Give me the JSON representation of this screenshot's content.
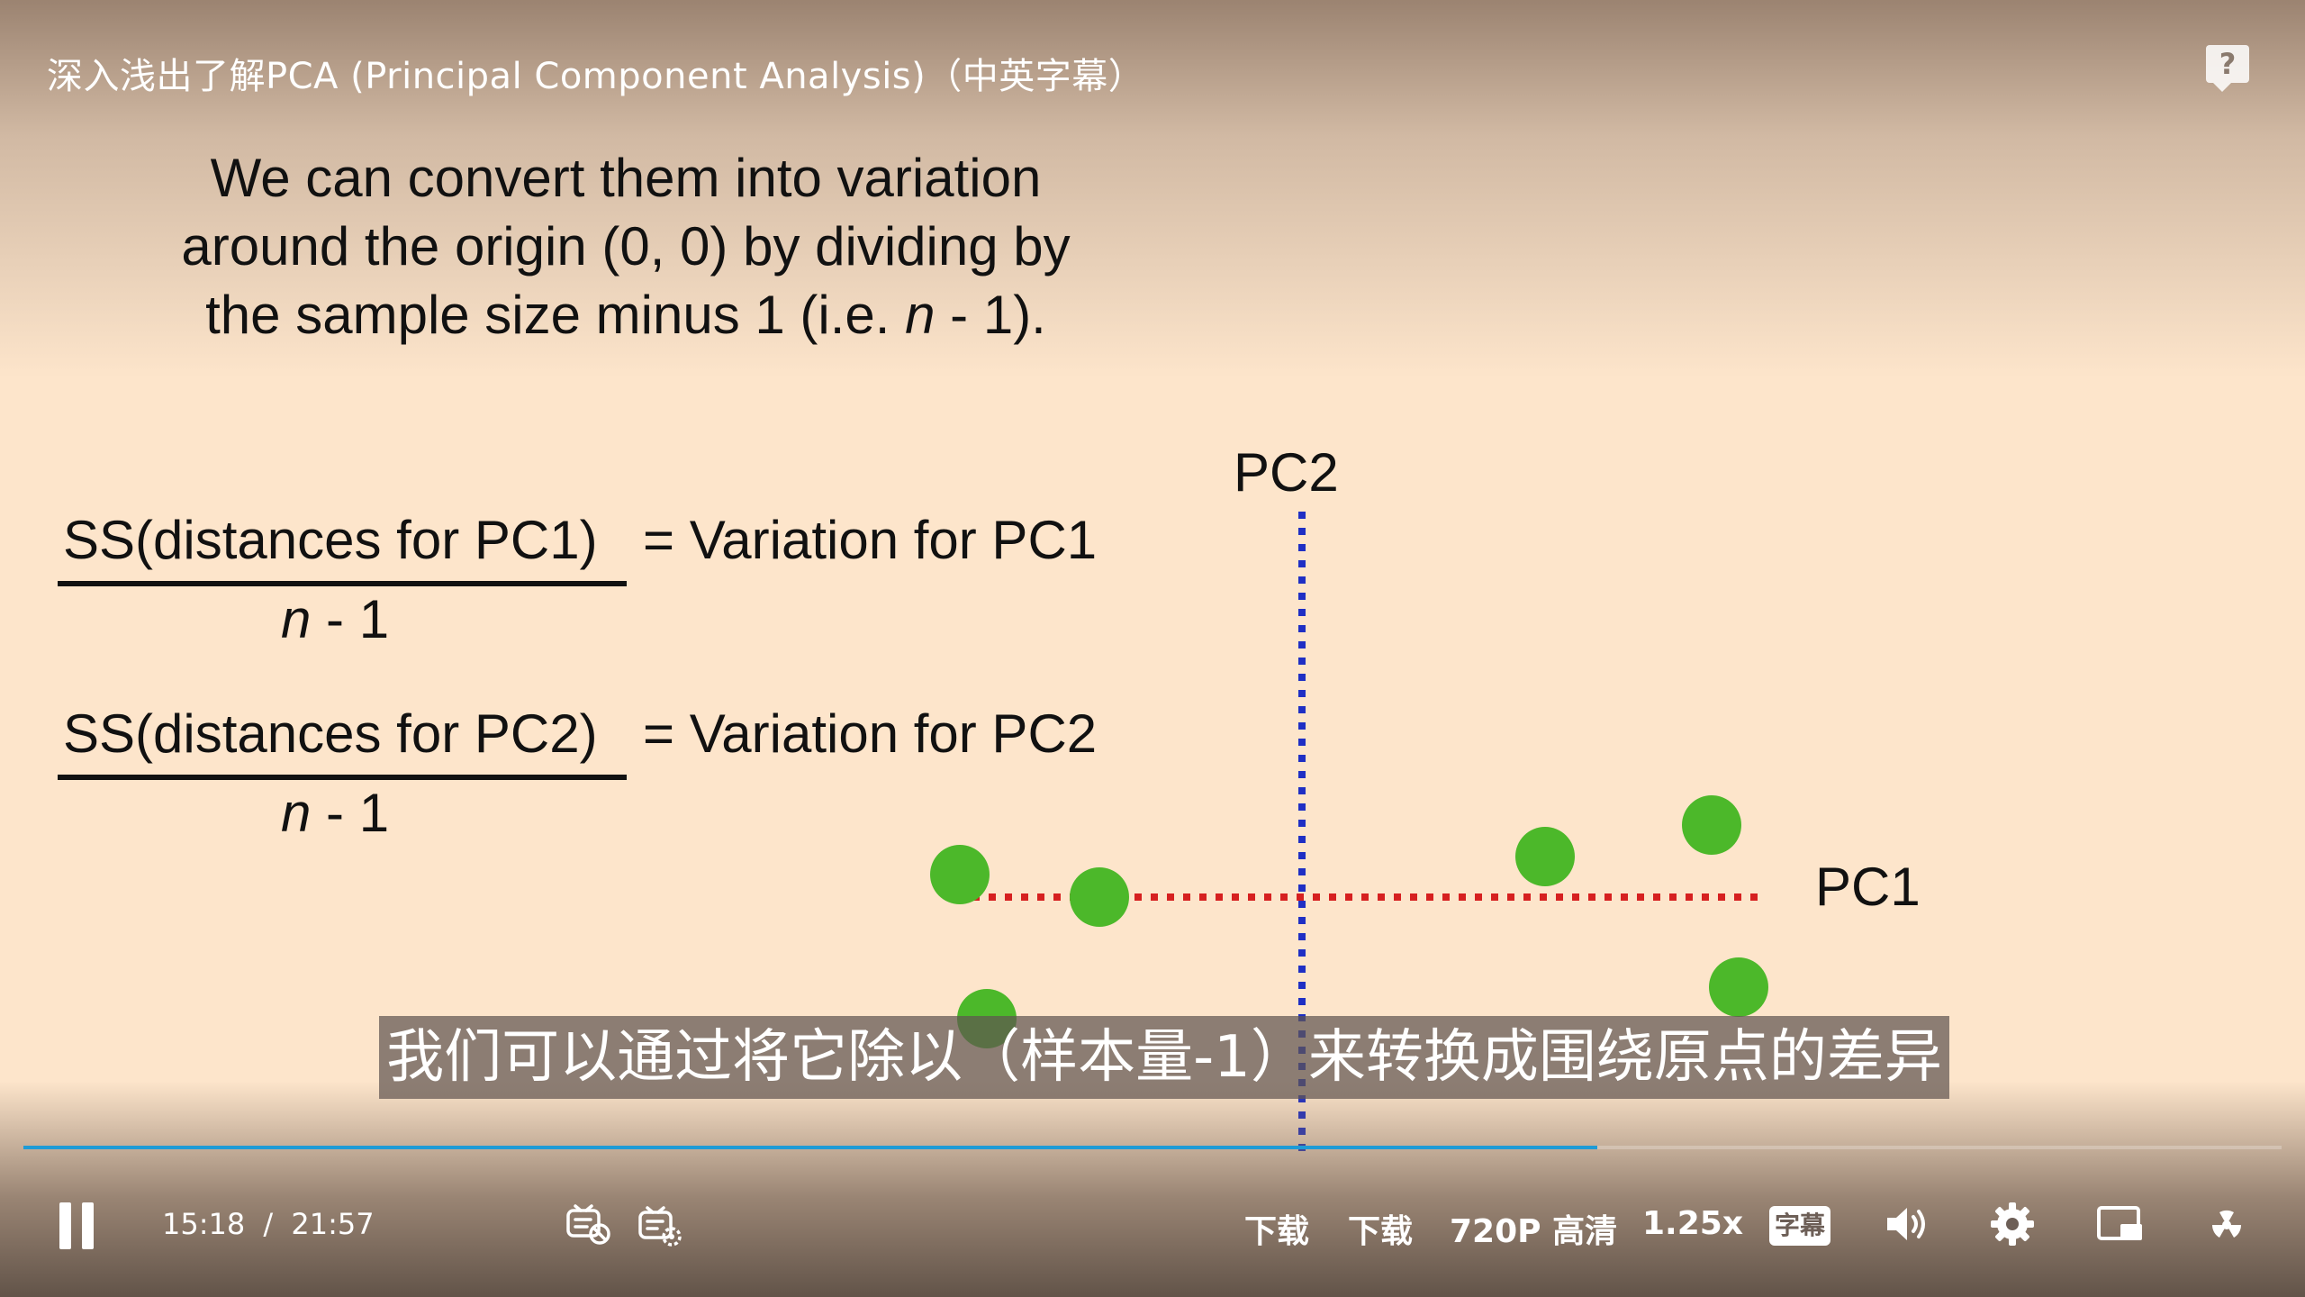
{
  "video": {
    "title": "深入浅出了解PCA (Principal Component Analysis)（中英字幕）",
    "help_label": "?"
  },
  "slide": {
    "lines": [
      "We can convert them into variation",
      "around the origin (0, 0) by dividing by",
      "the sample size minus 1 (i.e. "
    ],
    "line3_italic": "n",
    "line3_tail": " - 1).",
    "formula1": {
      "numerator": "SS(distances for PC1)",
      "denominator_var": "n",
      "denominator_tail": " - 1",
      "rhs": "= Variation for PC1"
    },
    "formula2": {
      "numerator": "SS(distances for PC2)",
      "denominator_var": "n",
      "denominator_tail": " - 1",
      "rhs": "= Variation for PC2"
    },
    "pc1_label": "PC1",
    "pc2_label": "PC2",
    "point_color": "#4cb82a",
    "pc1_axis_color": "#d62020",
    "pc2_axis_color": "#1f2fc4",
    "points": [
      {
        "x": -7.6,
        "y": 0.5
      },
      {
        "x": -4.5,
        "y": 0.0
      },
      {
        "x": -7.0,
        "y": -2.7
      },
      {
        "x": 5.4,
        "y": 0.9
      },
      {
        "x": 9.1,
        "y": 1.6
      },
      {
        "x": 9.7,
        "y": -2.0
      }
    ]
  },
  "subtitle": {
    "text": "我们可以通过将它除以（样本量-1）来转换成围绕原点的差异"
  },
  "player": {
    "progress_fraction": 0.697,
    "current_time": "15:18",
    "separator": "/",
    "duration": "21:57",
    "download_label_1": "下载",
    "download_label_2": "下载",
    "quality_label": "720P 高清",
    "speed_label": "1.25x",
    "subtitle_toggle_label": "字幕",
    "accent_color": "#1e9bd6"
  },
  "icons": {
    "play_pause": "pause-icon",
    "danmaku_off": "danmaku-off-icon",
    "danmaku_settings": "danmaku-settings-icon",
    "volume": "volume-icon",
    "settings": "gear-icon",
    "pip": "picture-in-picture-icon",
    "fullscreen": "fullscreen-icon"
  }
}
